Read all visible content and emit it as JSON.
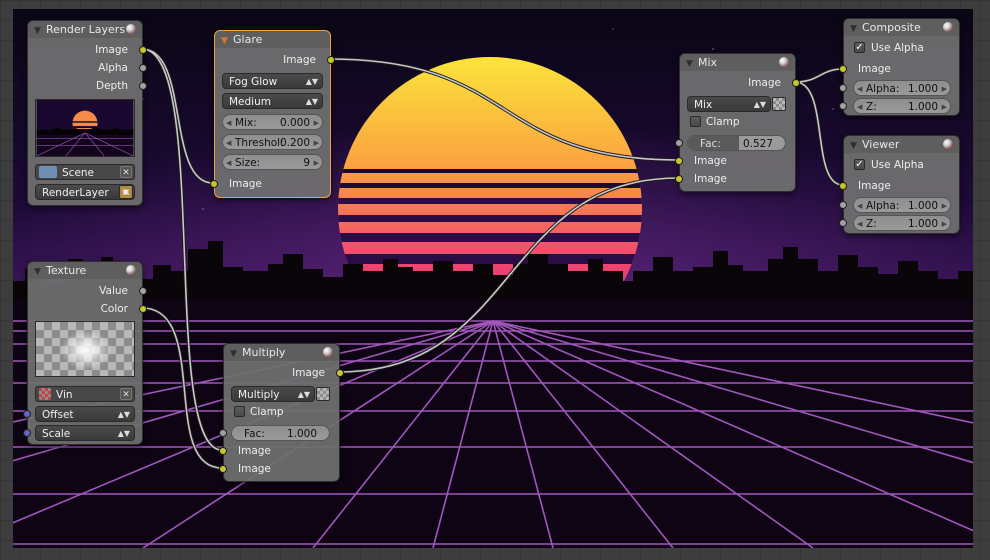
{
  "nodes": {
    "render_layers": {
      "title": "Render Layers",
      "outputs": [
        "Image",
        "Alpha",
        "Depth"
      ],
      "scene": "Scene",
      "layer": "RenderLayer"
    },
    "glare": {
      "title": "Glare",
      "output": "Image",
      "type": "Fog Glow",
      "quality": "Medium",
      "mix_label": "Mix:",
      "mix_value": "0.000",
      "threshold_label": "Threshol:",
      "threshold_value": "0.200",
      "size_label": "Size:",
      "size_value": "9",
      "input": "Image"
    },
    "mix": {
      "title": "Mix",
      "output": "Image",
      "blend": "Mix",
      "clamp_label": "Clamp",
      "clamp_checked": false,
      "fac_label": "Fac:",
      "fac_value": "0.527",
      "fac_fraction": 0.527,
      "inputs": [
        "Image",
        "Image"
      ]
    },
    "composite": {
      "title": "Composite",
      "use_alpha_label": "Use Alpha",
      "use_alpha_checked": true,
      "input": "Image",
      "alpha_label": "Alpha:",
      "alpha_value": "1.000",
      "z_label": "Z:",
      "z_value": "1.000"
    },
    "viewer": {
      "title": "Viewer",
      "use_alpha_label": "Use Alpha",
      "use_alpha_checked": true,
      "input": "Image",
      "alpha_label": "Alpha:",
      "alpha_value": "1.000",
      "z_label": "Z:",
      "z_value": "1.000"
    },
    "texture": {
      "title": "Texture",
      "outputs": [
        "Value",
        "Color"
      ],
      "texture_name": "Vin",
      "offset": "Offset",
      "scale": "Scale"
    },
    "multiply": {
      "title": "Multiply",
      "output": "Image",
      "blend": "Multiply",
      "clamp_label": "Clamp",
      "clamp_checked": false,
      "fac_label": "Fac:",
      "fac_value": "1.000",
      "inputs": [
        "Image",
        "Image"
      ]
    }
  },
  "colors": {
    "socket_color": "#c7c729",
    "socket_value": "#a1a1a1",
    "socket_vector": "#6363c7",
    "active_border": "#f0a043"
  },
  "icons": {
    "node_collapse": "triangle-down-icon",
    "node_preview": "sphere-icon",
    "scene": "scene-icon",
    "render_layer": "render-layer-icon",
    "texture": "checker-texture-icon",
    "close": "x-icon"
  }
}
